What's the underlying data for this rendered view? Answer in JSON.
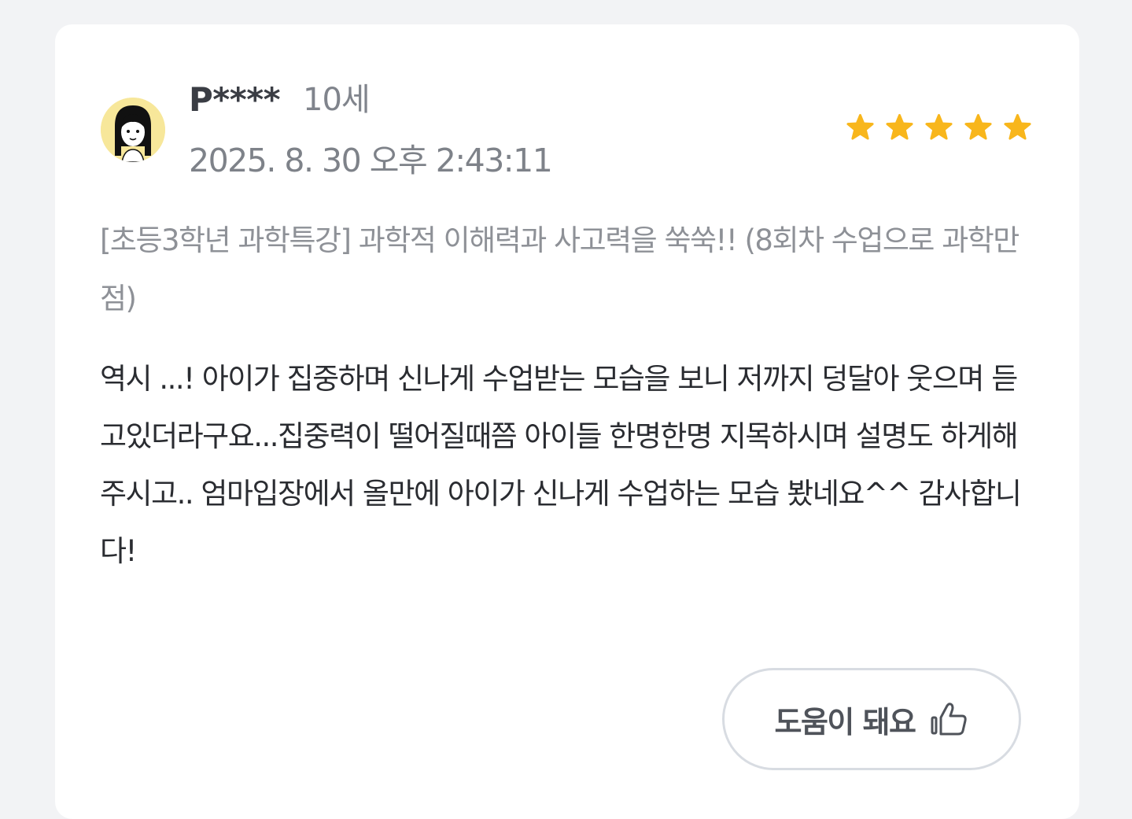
{
  "review": {
    "author": "P****",
    "age": "10세",
    "date": "2025. 8. 30 오후 2:43:11",
    "rating": 5,
    "course_title": "[초등3학년 과학특강] 과학적 이해력과 사고력을 쑥쑥!! (8회차 수업으로 과학만점)",
    "body": "역시 ...! 아이가 집중하며 신나게 수업받는 모습을 보니 저까지 덩달아 웃으며 듣고있더라구요...집중력이 떨어질때쯤 아이들 한명한명 지목하시며 설명도 하게해주시고.. 엄마입장에서 올만에 아이가 신나게 수업하는 모습 봤네요^^ 감사합니다!"
  },
  "actions": {
    "helpful_label": "도움이 돼요"
  },
  "icons": {
    "avatar": "girl-avatar-icon",
    "star": "star-icon",
    "helpful": "thumbs-up-icon"
  },
  "colors": {
    "star": "#f8b61c",
    "avatar_bg": "#f7e79a"
  }
}
